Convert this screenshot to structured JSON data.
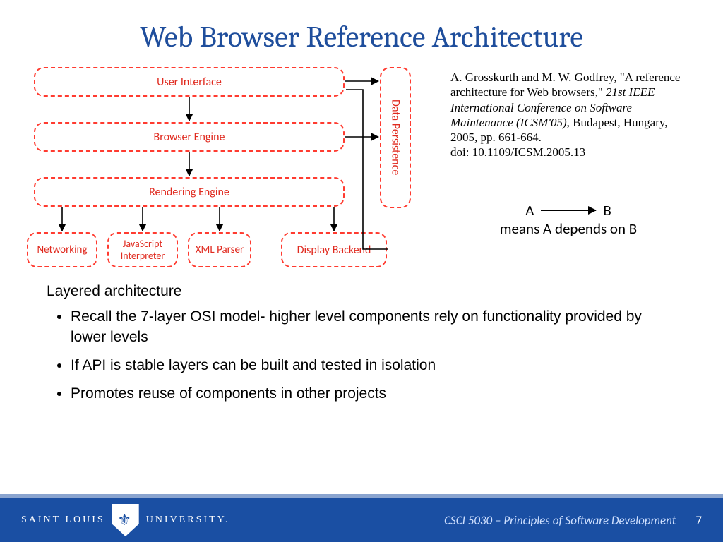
{
  "title": "Web Browser Reference Architecture",
  "diagram": {
    "ui": "User Interface",
    "browser_engine": "Browser Engine",
    "rendering_engine": "Rendering Engine",
    "networking": "Networking",
    "js_interpreter": "JavaScript Interpreter",
    "xml_parser": "XML Parser",
    "display_backend": "Display Backend",
    "data_persistence": "Data Persistence"
  },
  "citation": {
    "authors": "A. Grosskurth and M. W. Godfrey, \"A reference architecture for Web browsers,\" ",
    "venue": "21st IEEE International Conference on Software Maintenance (ICSM'05)",
    "rest": ", Budapest, Hungary, 2005, pp. 661-664.",
    "doi": "doi: 10.1109/ICSM.2005.13"
  },
  "legend": {
    "a": "A",
    "b": "B",
    "means": "means A depends on B"
  },
  "body": {
    "lead": "Layered architecture",
    "b1": "Recall the 7-layer OSI model- higher level components rely on functionality provided by lower levels",
    "b2": "If API is stable layers can be built and tested in isolation",
    "b3": "Promotes reuse of components in other projects"
  },
  "footer": {
    "uni_left": "SAINT LOUIS",
    "uni_right": "UNIVERSITY.",
    "course": "CSCI 5030 – Principles of Software Development",
    "page": "7"
  }
}
